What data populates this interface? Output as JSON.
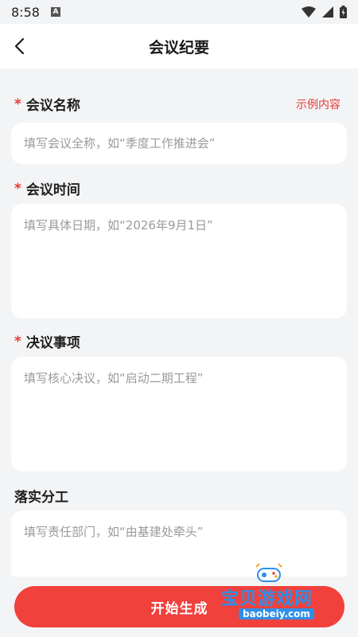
{
  "status": {
    "time": "8:58"
  },
  "header": {
    "title": "会议纪要"
  },
  "form": {
    "example_link": "示例内容",
    "fields": [
      {
        "label": "会议名称",
        "required": "*",
        "placeholder": "填写会议全称，如“季度工作推进会”"
      },
      {
        "label": "会议时间",
        "required": "*",
        "placeholder": "填写具体日期，如“2026年9月1日”"
      },
      {
        "label": "决议事项",
        "required": "*",
        "placeholder": "填写核心决议，如“启动二期工程”"
      },
      {
        "label": "落实分工",
        "placeholder": "填写责任部门，如“由基建处牵头”"
      }
    ]
  },
  "footer": {
    "button_label": "开始生成"
  },
  "watermark": {
    "text": "宝贝游戏网",
    "url": "baobeiy.com"
  }
}
